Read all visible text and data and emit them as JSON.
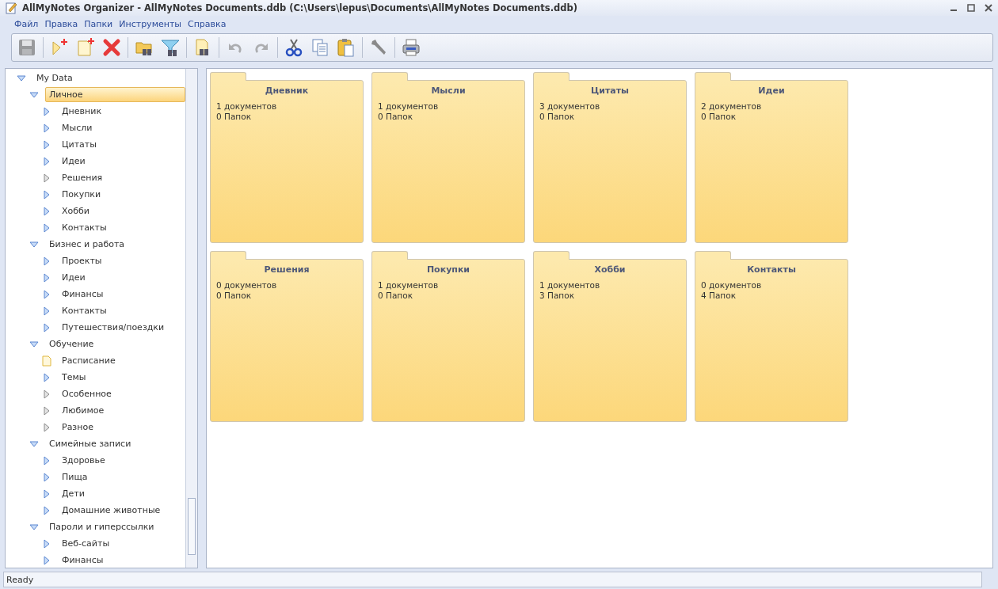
{
  "window": {
    "title": "AllMyNotes Organizer - AllMyNotes Documents.ddb (C:\\Users\\lepus\\Documents\\AllMyNotes Documents.ddb)"
  },
  "menu": [
    "Файл",
    "Правка",
    "Папки",
    "Инструменты",
    "Справка"
  ],
  "toolbar": [
    [
      {
        "kind": "save",
        "disabled": true
      }
    ],
    [
      {
        "kind": "new-folder",
        "disabled": false
      },
      {
        "kind": "new-note",
        "disabled": false
      },
      {
        "kind": "delete",
        "disabled": false
      }
    ],
    [
      {
        "kind": "find-folder",
        "disabled": false
      },
      {
        "kind": "filter",
        "disabled": false
      }
    ],
    [
      {
        "kind": "find-note",
        "disabled": false
      }
    ],
    [
      {
        "kind": "undo",
        "disabled": true
      },
      {
        "kind": "redo",
        "disabled": true
      }
    ],
    [
      {
        "kind": "cut",
        "disabled": false
      },
      {
        "kind": "copy",
        "disabled": false
      },
      {
        "kind": "paste",
        "disabled": false
      }
    ],
    [
      {
        "kind": "settings",
        "disabled": false
      }
    ],
    [
      {
        "kind": "print",
        "disabled": false
      }
    ]
  ],
  "tree": [
    {
      "label": "My Data",
      "expanded": true,
      "selected": false,
      "children": [
        {
          "label": "Личное",
          "expanded": true,
          "selected": true,
          "children": [
            {
              "label": "Дневник",
              "kind": "folder",
              "selected": false
            },
            {
              "label": "Мысли",
              "kind": "folder",
              "selected": false
            },
            {
              "label": "Цитаты",
              "kind": "folder",
              "selected": false
            },
            {
              "label": "Идеи",
              "kind": "folder",
              "selected": false
            },
            {
              "label": "Решения",
              "kind": "empty",
              "selected": false
            },
            {
              "label": "Покупки",
              "kind": "folder",
              "selected": false
            },
            {
              "label": "Хобби",
              "kind": "folder",
              "selected": false
            },
            {
              "label": "Контакты",
              "kind": "folder",
              "selected": false
            }
          ]
        },
        {
          "label": "Бизнес и работа",
          "expanded": true,
          "selected": false,
          "children": [
            {
              "label": "Проекты",
              "kind": "folder",
              "selected": false
            },
            {
              "label": "Идеи",
              "kind": "folder",
              "selected": false
            },
            {
              "label": "Финансы",
              "kind": "folder",
              "selected": false
            },
            {
              "label": "Контакты",
              "kind": "folder",
              "selected": false
            },
            {
              "label": "Путешествия/поездки",
              "kind": "folder",
              "selected": false
            }
          ]
        },
        {
          "label": "Обучение",
          "expanded": true,
          "selected": false,
          "children": [
            {
              "label": "Расписание",
              "kind": "note",
              "selected": false
            },
            {
              "label": "Темы",
              "kind": "folder",
              "selected": false
            },
            {
              "label": "Особенное",
              "kind": "empty",
              "selected": false
            },
            {
              "label": "Любимое",
              "kind": "empty",
              "selected": false
            },
            {
              "label": "Разное",
              "kind": "empty",
              "selected": false
            }
          ]
        },
        {
          "label": "Симейные записи",
          "expanded": true,
          "selected": false,
          "children": [
            {
              "label": "Здоровье",
              "kind": "folder",
              "selected": false
            },
            {
              "label": "Пища",
              "kind": "folder",
              "selected": false
            },
            {
              "label": "Дети",
              "kind": "folder",
              "selected": false
            },
            {
              "label": "Домашние животные",
              "kind": "folder",
              "selected": false
            }
          ]
        },
        {
          "label": "Пароли и гиперссылки",
          "expanded": true,
          "selected": false,
          "children": [
            {
              "label": "Веб-сайты",
              "kind": "folder",
              "selected": false
            },
            {
              "label": "Финансы",
              "kind": "folder",
              "selected": false
            }
          ]
        }
      ]
    }
  ],
  "cards": [
    {
      "title": "Дневник",
      "documents": "1 документов",
      "folders": "0 Папок"
    },
    {
      "title": "Мысли",
      "documents": "1 документов",
      "folders": "0 Папок"
    },
    {
      "title": "Цитаты",
      "documents": "3 документов",
      "folders": "0 Папок"
    },
    {
      "title": "Идеи",
      "documents": "2 документов",
      "folders": "0 Папок"
    },
    {
      "title": "Решения",
      "documents": "0 документов",
      "folders": "0 Папок"
    },
    {
      "title": "Покупки",
      "documents": "1 документов",
      "folders": "0 Папок"
    },
    {
      "title": "Хобби",
      "documents": "1 документов",
      "folders": "3 Папок"
    },
    {
      "title": "Контакты",
      "documents": "0 документов",
      "folders": "4 Папок"
    }
  ],
  "status_bar": "Ready"
}
